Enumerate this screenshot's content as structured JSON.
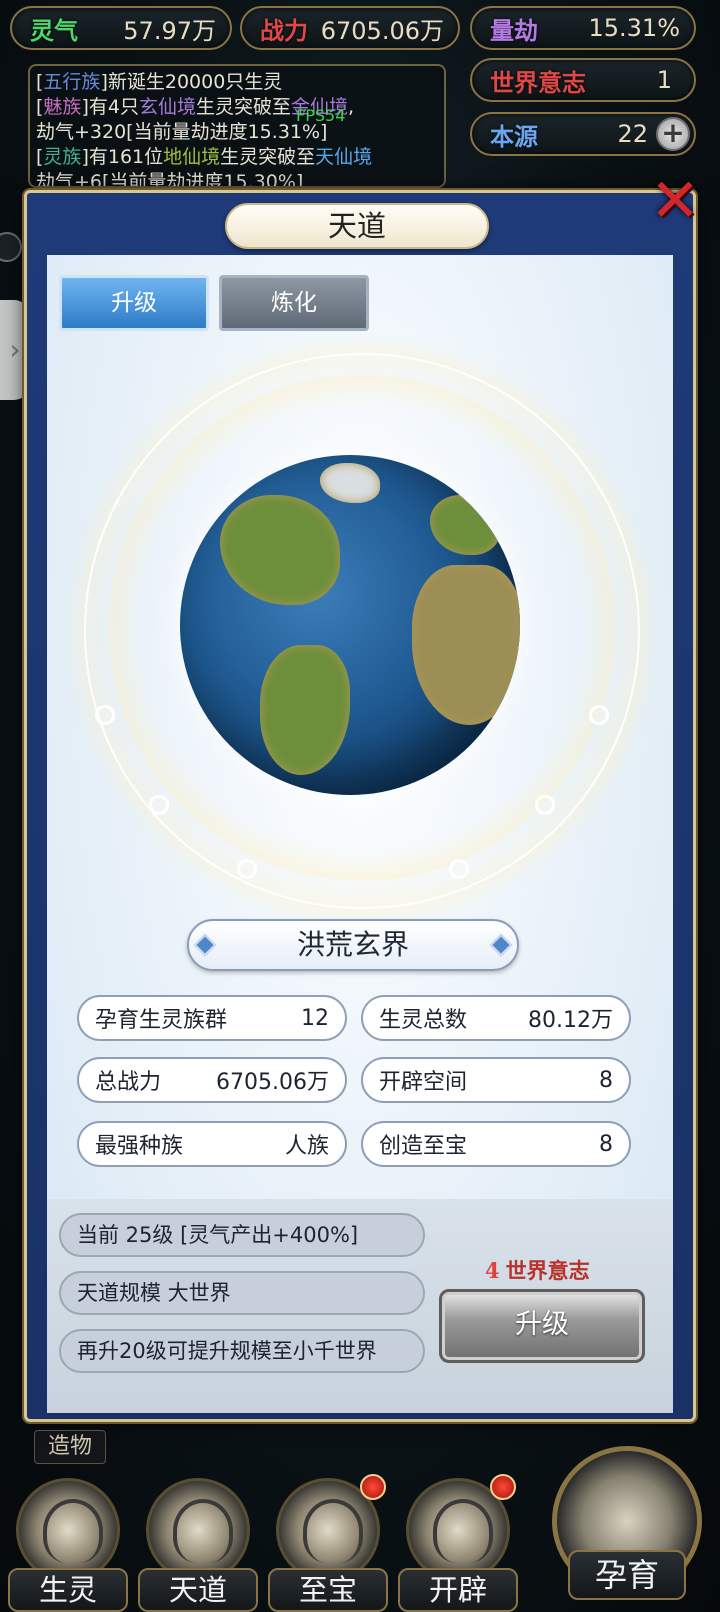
{
  "top_bar": {
    "spirit_qi": {
      "label": "灵气",
      "value": "57.97万",
      "color": "#4fd66a"
    },
    "combat_power": {
      "label": "战力",
      "value": "6705.06万",
      "color": "#e04848"
    },
    "calamity": {
      "label": "量劫",
      "value": "15.31%",
      "color": "#b47ae6"
    },
    "world_will": {
      "label": "世界意志",
      "value": "1",
      "color": "#e04848"
    },
    "origin": {
      "label": "本源",
      "value": "22",
      "color": "#6aa6f0"
    }
  },
  "fps": "FPS54",
  "log": {
    "line1": {
      "race": "五行族",
      "text": "新诞生20000只生灵"
    },
    "line2": {
      "race": "魅族",
      "pre": "有4只",
      "realm1": "玄仙境",
      "mid": "生灵突破至",
      "realm2": "金仙境",
      "post": ","
    },
    "line3": {
      "text": "劫气+320[当前量劫进度15.31%]"
    },
    "line4": {
      "race": "灵族",
      "pre": "有161位",
      "realm1": "地仙境",
      "mid": "生灵突破至",
      "realm2": "天仙境"
    },
    "line5": {
      "text": "劫气+6[当前量劫进度15.30%]"
    }
  },
  "panel": {
    "title": "天道",
    "tabs": [
      {
        "label": "升级",
        "active": true
      },
      {
        "label": "炼化",
        "active": false
      }
    ],
    "realm_name": "洪荒玄界",
    "stats": [
      {
        "label": "孕育生灵族群",
        "value": "12"
      },
      {
        "label": "生灵总数",
        "value": "80.12万"
      },
      {
        "label": "总战力",
        "value": "6705.06万"
      },
      {
        "label": "开辟空间",
        "value": "8"
      },
      {
        "label": "最强种族",
        "value": "人族"
      },
      {
        "label": "创造至宝",
        "value": "8"
      }
    ],
    "info": [
      "当前 25级 [灵气产出+400%]",
      "天道规模 大世界",
      "再升20级可提升规模至小千世界"
    ],
    "cost": {
      "amount": "4",
      "label": "世界意志"
    },
    "upgrade_button": "升级"
  },
  "crafting_label": "造物",
  "nav": [
    {
      "label": "生灵",
      "badge": false
    },
    {
      "label": "天道",
      "badge": false
    },
    {
      "label": "至宝",
      "badge": true
    },
    {
      "label": "开辟",
      "badge": true
    }
  ],
  "nav_main": {
    "label": "孕育"
  }
}
